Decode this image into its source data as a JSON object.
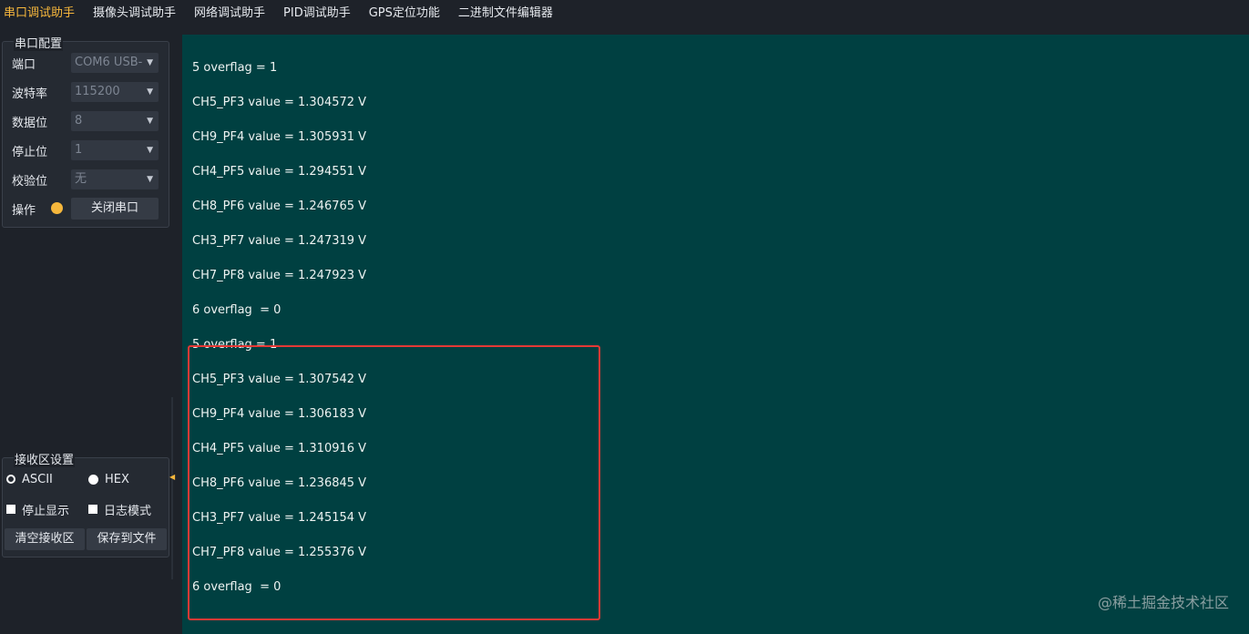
{
  "menu": {
    "tabs": [
      {
        "label": "串口调试助手"
      },
      {
        "label": "摄像头调试助手"
      },
      {
        "label": "网络调试助手"
      },
      {
        "label": "PID调试助手"
      },
      {
        "label": "GPS定位功能"
      },
      {
        "label": "二进制文件编辑器"
      }
    ]
  },
  "serial_config": {
    "title": "串口配置",
    "port_label": "端口",
    "port_value": "COM6 USB-",
    "baud_label": "波特率",
    "baud_value": "115200",
    "databits_label": "数据位",
    "databits_value": "8",
    "stopbits_label": "停止位",
    "stopbits_value": "1",
    "parity_label": "校验位",
    "parity_value": "无",
    "op_label": "操作",
    "close_button": "关闭串口",
    "status_color": "#f6b73c"
  },
  "receive_settings": {
    "title": "接收区设置",
    "ascii_label": "ASCII",
    "hex_label": "HEX",
    "stop_display_label": "停止显示",
    "log_mode_label": "日志模式",
    "clear_button": "清空接收区",
    "save_button": "保存到文件"
  },
  "receive_area": {
    "lines": [
      "5 overflag = 1",
      "CH5_PF3 value = 1.304572 V",
      "CH9_PF4 value = 1.305931 V",
      "CH4_PF5 value = 1.294551 V",
      "CH8_PF6 value = 1.246765 V",
      "CH3_PF7 value = 1.247319 V",
      "CH7_PF8 value = 1.247923 V",
      "6 overflag  = 0",
      "5 overflag = 1",
      "CH5_PF3 value = 1.307542 V",
      "CH9_PF4 value = 1.306183 V",
      "CH4_PF5 value = 1.310916 V",
      "CH8_PF6 value = 1.236845 V",
      "CH3_PF7 value = 1.245154 V",
      "CH7_PF8 value = 1.255376 V",
      "6 overflag  = 0"
    ],
    "highlight_color": "#e53935",
    "background_color": "#004041"
  },
  "watermark": "@稀土掘金技术社区"
}
